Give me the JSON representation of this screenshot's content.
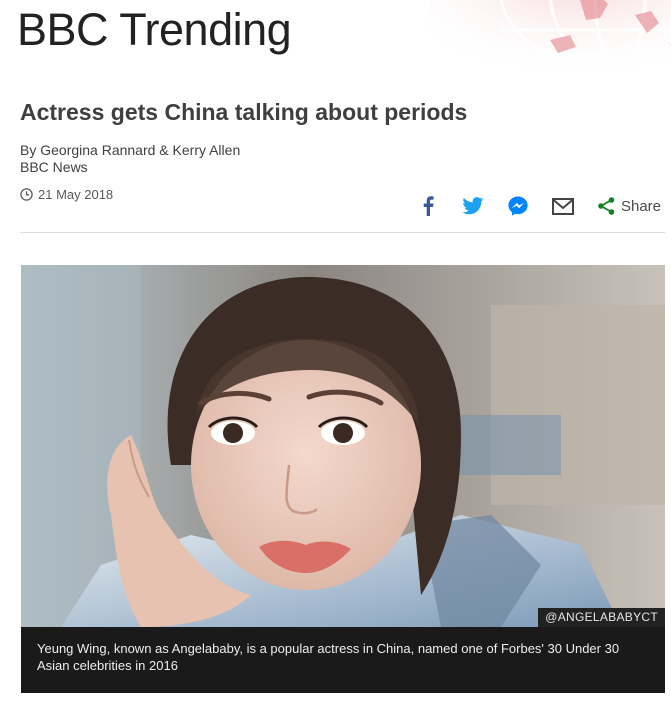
{
  "masthead": {
    "title": "BBC Trending"
  },
  "article": {
    "headline": "Actress gets China talking about periods",
    "authors": "By Georgina Rannard & Kerry Allen",
    "source": "BBC News",
    "date": "21 May 2018"
  },
  "share": {
    "label": "Share",
    "icons": [
      "facebook-icon",
      "twitter-icon",
      "messenger-icon",
      "email-icon",
      "share-icon"
    ],
    "colors": {
      "facebook": "#3b5998",
      "twitter": "#1da1f2",
      "messenger": "#0084ff",
      "email": "#444444",
      "share": "#128224"
    }
  },
  "image": {
    "credit": "@ANGELABABYCT",
    "caption": "Yeung Wing, known as Angelababy, is a popular actress in China, named one of Forbes' 30 Under 30 Asian celebrities in 2016"
  },
  "colors": {
    "headline": "#3f3f42",
    "caption_bg": "#1a1a1a",
    "masthead_accent": "#e8a5a8"
  }
}
